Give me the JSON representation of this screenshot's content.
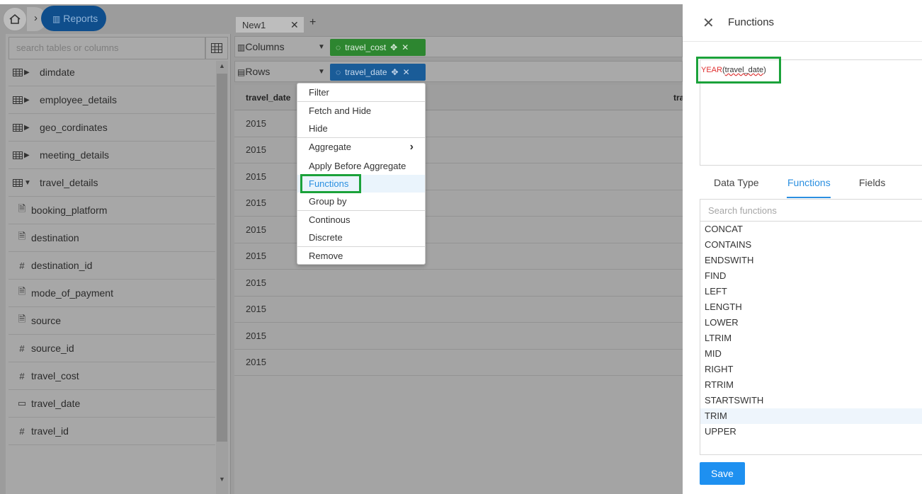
{
  "breadcrumb": {
    "home_icon": "home-icon",
    "current": "Reports"
  },
  "left_panel": {
    "search_placeholder": "search tables or columns",
    "tables": [
      {
        "label": "dimdate",
        "expanded": false
      },
      {
        "label": "employee_details",
        "expanded": false
      },
      {
        "label": "geo_cordinates",
        "expanded": false
      },
      {
        "label": "meeting_details",
        "expanded": false
      },
      {
        "label": "travel_details",
        "expanded": true
      }
    ],
    "columns": [
      {
        "label": "booking_platform",
        "icon": "document-icon",
        "glyph": "🗎"
      },
      {
        "label": "destination",
        "icon": "document-icon",
        "glyph": "🗎"
      },
      {
        "label": "destination_id",
        "icon": "hash-icon",
        "glyph": "#"
      },
      {
        "label": "mode_of_payment",
        "icon": "document-icon",
        "glyph": "🗎"
      },
      {
        "label": "source",
        "icon": "document-icon",
        "glyph": "🗎"
      },
      {
        "label": "source_id",
        "icon": "hash-icon",
        "glyph": "#"
      },
      {
        "label": "travel_cost",
        "icon": "hash-icon",
        "glyph": "#"
      },
      {
        "label": "travel_date",
        "icon": "calendar-icon",
        "glyph": "▭"
      },
      {
        "label": "travel_id",
        "icon": "hash-icon",
        "glyph": "#"
      }
    ]
  },
  "tabs": {
    "active": "New1",
    "add": "+"
  },
  "shelves": {
    "columns_label": "Columns",
    "rows_label": "Rows",
    "columns_pill": "travel_cost",
    "rows_pill": "travel_date"
  },
  "grid": {
    "headers": [
      "travel_date",
      "tra"
    ],
    "rows": [
      "2015",
      "2015",
      "2015",
      "2015",
      "2015",
      "2015",
      "2015",
      "2015",
      "2015",
      "2015"
    ]
  },
  "context_menu": {
    "items": [
      "Filter",
      "Fetch and Hide",
      "Hide",
      "Aggregate",
      "Apply Before Aggregate",
      "Functions",
      "Group by",
      "Continous",
      "Discrete",
      "Remove"
    ],
    "active": "Functions"
  },
  "functions_panel": {
    "title": "Functions",
    "expression_fn": "YEAR",
    "expression_arg": "travel_date",
    "tabs": [
      "Data Type",
      "Functions",
      "Fields"
    ],
    "active_tab": "Functions",
    "search_placeholder": "Search functions",
    "functions": [
      "CONCAT",
      "CONTAINS",
      "ENDSWITH",
      "FIND",
      "LEFT",
      "LENGTH",
      "LOWER",
      "LTRIM",
      "MID",
      "RIGHT",
      "RTRIM",
      "STARTSWITH",
      "TRIM",
      "UPPER"
    ],
    "hovered": "TRIM",
    "save_label": "Save"
  },
  "colors": {
    "accent": "#2b8fe0",
    "highlight": "#1ba23a",
    "pill_green": "#2d8630",
    "pill_blue": "#1a5c98"
  }
}
